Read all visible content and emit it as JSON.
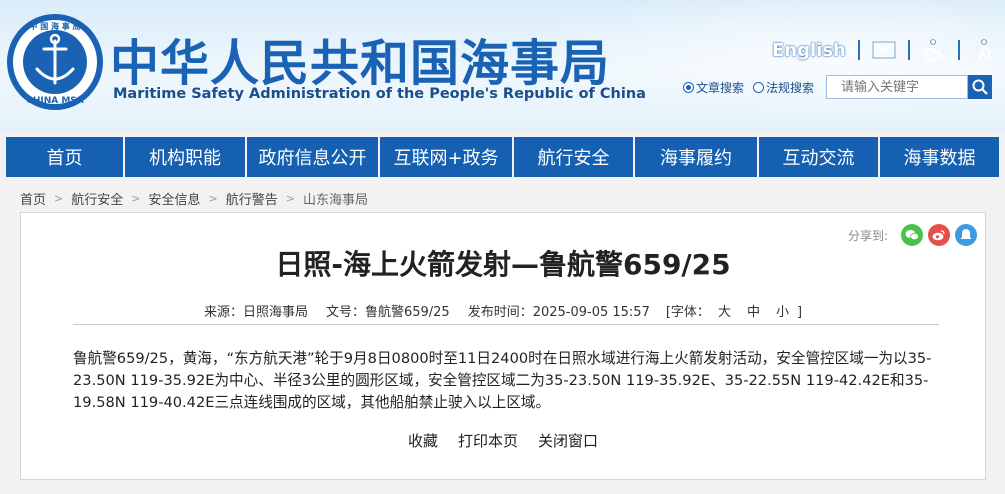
{
  "header": {
    "logo_text": "中国海事局 CHINA MSA",
    "title": "中华人民共和国海事局",
    "subtitle": "Maritime Safety Administration of the People's Republic of China",
    "english_link": "English",
    "icons": [
      "mail-icon",
      "accessibility-icon",
      "elderly-mode-icon"
    ]
  },
  "search": {
    "option_article": "文章搜索",
    "option_regulation": "法规搜索",
    "selected": "文章搜索",
    "placeholder": "请输入关键字"
  },
  "nav": {
    "items": [
      "首页",
      "机构职能",
      "政府信息公开",
      "互联网+政务",
      "航行安全",
      "海事履约",
      "互动交流",
      "海事数据"
    ]
  },
  "breadcrumb": [
    "首页",
    "航行安全",
    "安全信息",
    "航行警告",
    "山东海事局"
  ],
  "article": {
    "share_label": "分享到:",
    "title": "日照-海上火箭发射—鲁航警659/25",
    "source": "来源：日照海事局",
    "doc_no": "文号：鲁航警659/25",
    "publish_time": "发布时间：2025-09-05 15:57",
    "font_label": "[字体：",
    "font_large": "大",
    "font_medium": "中",
    "font_small": "小",
    "font_close": "]",
    "body": "鲁航警659/25，黄海，“东方航天港”轮于9月8日0800时至11日2400时在日照水域进行海上火箭发射活动，安全管控区域一为以35-23.50N 119-35.92E为中心、半径3公里的圆形区域，安全管控区域二为35-23.50N 119-35.92E、35-22.55N 119-42.42E和35-19.58N 119-40.42E三点连线围成的区域，其他船舶禁止驶入以上区域。",
    "actions": [
      "收藏",
      "打印本页",
      "关闭窗口"
    ]
  },
  "colors": {
    "brand_blue": "#1660b2",
    "wechat_green": "#4bc24b",
    "weibo_red": "#e5504a",
    "qzone_blue": "#3d9be0"
  }
}
